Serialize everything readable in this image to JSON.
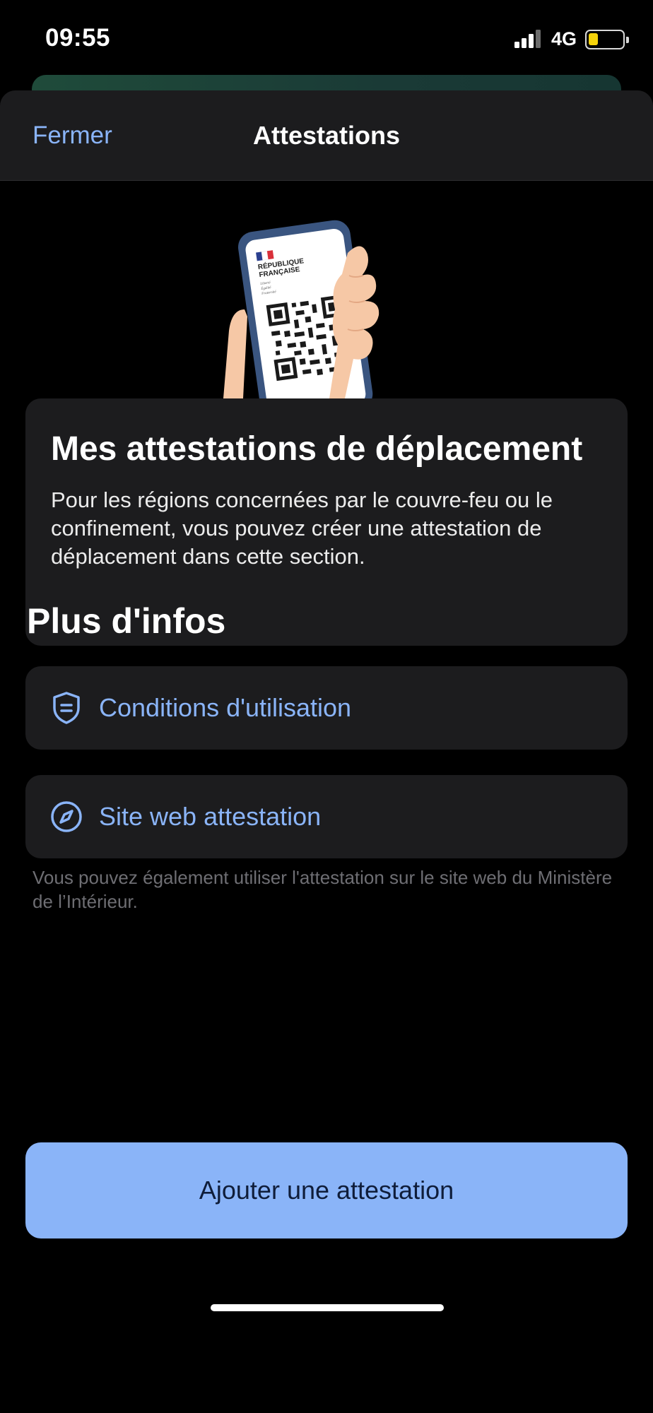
{
  "status_bar": {
    "time": "09:55",
    "network": "4G",
    "battery_color": "#f5d30a"
  },
  "nav": {
    "close_label": "Fermer",
    "title": "Attestations"
  },
  "illustration": {
    "line1": "RÉPUBLIQUE",
    "line2": "FRANÇAISE",
    "motto1": "Liberté",
    "motto2": "Égalité",
    "motto3": "Fraternité"
  },
  "info_card": {
    "title": "Mes attestations de déplacement",
    "text": "Pour les régions concernées par le couvre-feu ou le confinement, vous pouvez créer une attestation de déplacement dans cette section."
  },
  "more_info": {
    "title": "Plus d'infos",
    "items": [
      {
        "label": "Conditions d'utilisation",
        "icon": "shield-icon"
      },
      {
        "label": "Site web attestation",
        "icon": "compass-icon"
      }
    ],
    "footnote": "Vous pouvez également utiliser l'attestation sur le site web du Ministère de l’Intérieur."
  },
  "actions": {
    "add_label": "Ajouter une attestation"
  },
  "colors": {
    "accent": "#8ab4f8",
    "card": "#1c1c1e",
    "background": "#000000"
  }
}
